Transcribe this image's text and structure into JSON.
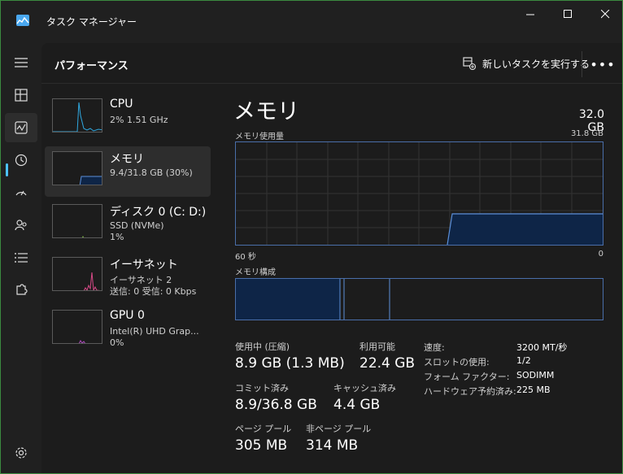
{
  "window": {
    "title": "タスク マネージャー",
    "controls": {
      "minimize": "—",
      "maximize": "☐",
      "close": "✕"
    }
  },
  "header": {
    "page_title": "パフォーマンス",
    "run_task_label": "新しいタスクを実行する",
    "more_label": "•••"
  },
  "nav": [
    {
      "name": "hamburger-icon"
    },
    {
      "name": "processes-icon"
    },
    {
      "name": "performance-icon",
      "active": true
    },
    {
      "name": "app-history-icon"
    },
    {
      "name": "startup-apps-icon"
    },
    {
      "name": "users-icon"
    },
    {
      "name": "details-icon"
    },
    {
      "name": "services-icon"
    },
    {
      "name": "settings-icon"
    }
  ],
  "devices": [
    {
      "name": "CPU",
      "line1": "2%  1.51 GHz",
      "line2": ""
    },
    {
      "name": "メモリ",
      "line1": "9.4/31.8 GB (30%)",
      "line2": "",
      "selected": true
    },
    {
      "name": "ディスク 0 (C: D:)",
      "line1": "SSD (NVMe)",
      "line2": "1%"
    },
    {
      "name": "イーサネット",
      "line1": "イーサネット 2",
      "line2": "送信: 0 受信: 0 Kbps"
    },
    {
      "name": "GPU 0",
      "line1": "Intel(R) UHD Grap...",
      "line2": "0%"
    }
  ],
  "memory": {
    "title": "メモリ",
    "total": "32.0 GB",
    "usage_label": "メモリ使用量",
    "usage_max": "31.8 GB",
    "time_left": "60 秒",
    "time_right": "0",
    "composition_label": "メモリ構成",
    "usage_fraction": 0.3,
    "stats": {
      "in_use_label": "使用中 (圧縮)",
      "in_use_value": "8.9 GB (1.3 MB)",
      "available_label": "利用可能",
      "available_value": "22.4 GB",
      "committed_label": "コミット済み",
      "committed_value": "8.9/36.8 GB",
      "cached_label": "キャッシュ済み",
      "cached_value": "4.4 GB",
      "paged_label": "ページ プール",
      "paged_value": "305 MB",
      "nonpaged_label": "非ページ プール",
      "nonpaged_value": "314 MB"
    },
    "details": [
      {
        "key": "速度:",
        "value": "3200 MT/秒"
      },
      {
        "key": "スロットの使用:",
        "value": "1/2"
      },
      {
        "key": "フォーム ファクター:",
        "value": "SODIMM"
      },
      {
        "key": "ハードウェア予約済み:",
        "value": "225 MB"
      }
    ]
  },
  "colors": {
    "accent": "#4cc2ff",
    "memory_line": "#5b8fd9",
    "memory_fill": "#0e2547",
    "cpu_line": "#2fa8e0",
    "net_line": "#d84a88",
    "gpu_line": "#b04cc0"
  }
}
